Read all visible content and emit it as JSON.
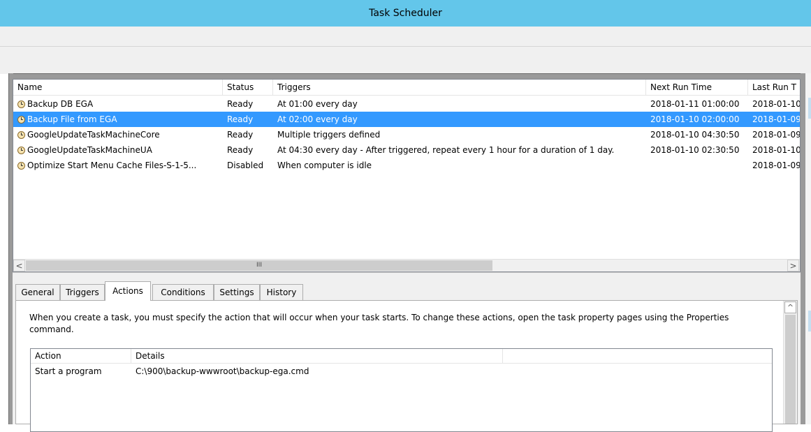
{
  "window": {
    "title": "Task Scheduler"
  },
  "task_list": {
    "columns": [
      "Name",
      "Status",
      "Triggers",
      "Next Run Time",
      "Last Run T"
    ],
    "rows": [
      {
        "name": "Backup DB EGA",
        "status": "Ready",
        "triggers": "At 01:00 every day",
        "next_run": "2018-01-11 01:00:00",
        "last_run": "2018-01-10",
        "selected": false
      },
      {
        "name": "Backup File from EGA",
        "status": "Ready",
        "triggers": "At 02:00 every day",
        "next_run": "2018-01-10 02:00:00",
        "last_run": "2018-01-09",
        "selected": true
      },
      {
        "name": "GoogleUpdateTaskMachineCore",
        "status": "Ready",
        "triggers": "Multiple triggers defined",
        "next_run": "2018-01-10 04:30:50",
        "last_run": "2018-01-09",
        "selected": false
      },
      {
        "name": "GoogleUpdateTaskMachineUA",
        "status": "Ready",
        "triggers": "At 04:30 every day - After triggered, repeat every 1 hour for a duration of 1 day.",
        "next_run": "2018-01-10 02:30:50",
        "last_run": "2018-01-10",
        "selected": false
      },
      {
        "name": "Optimize Start Menu Cache Files-S-1-5...",
        "status": "Disabled",
        "triggers": "When computer is idle",
        "next_run": "",
        "last_run": "2018-01-09",
        "selected": false
      }
    ],
    "scroll": {
      "left_arrow": "<",
      "right_arrow": ">",
      "thumb_grip": "III"
    }
  },
  "tabs": {
    "items": [
      "General",
      "Triggers",
      "Actions",
      "Conditions",
      "Settings",
      "History"
    ],
    "active": "Actions"
  },
  "actions_tab": {
    "description": "When you create a task, you must specify the action that will occur when your task starts.  To change these actions, open the task property pages using the Properties command.",
    "columns": [
      "Action",
      "Details"
    ],
    "rows": [
      {
        "action": "Start a program",
        "details": "C:\\900\\backup-wwwroot\\backup-ega.cmd"
      }
    ],
    "scroll_up": "^"
  },
  "colors": {
    "titlebar": "#63c6ea",
    "selection": "#3399ff"
  }
}
